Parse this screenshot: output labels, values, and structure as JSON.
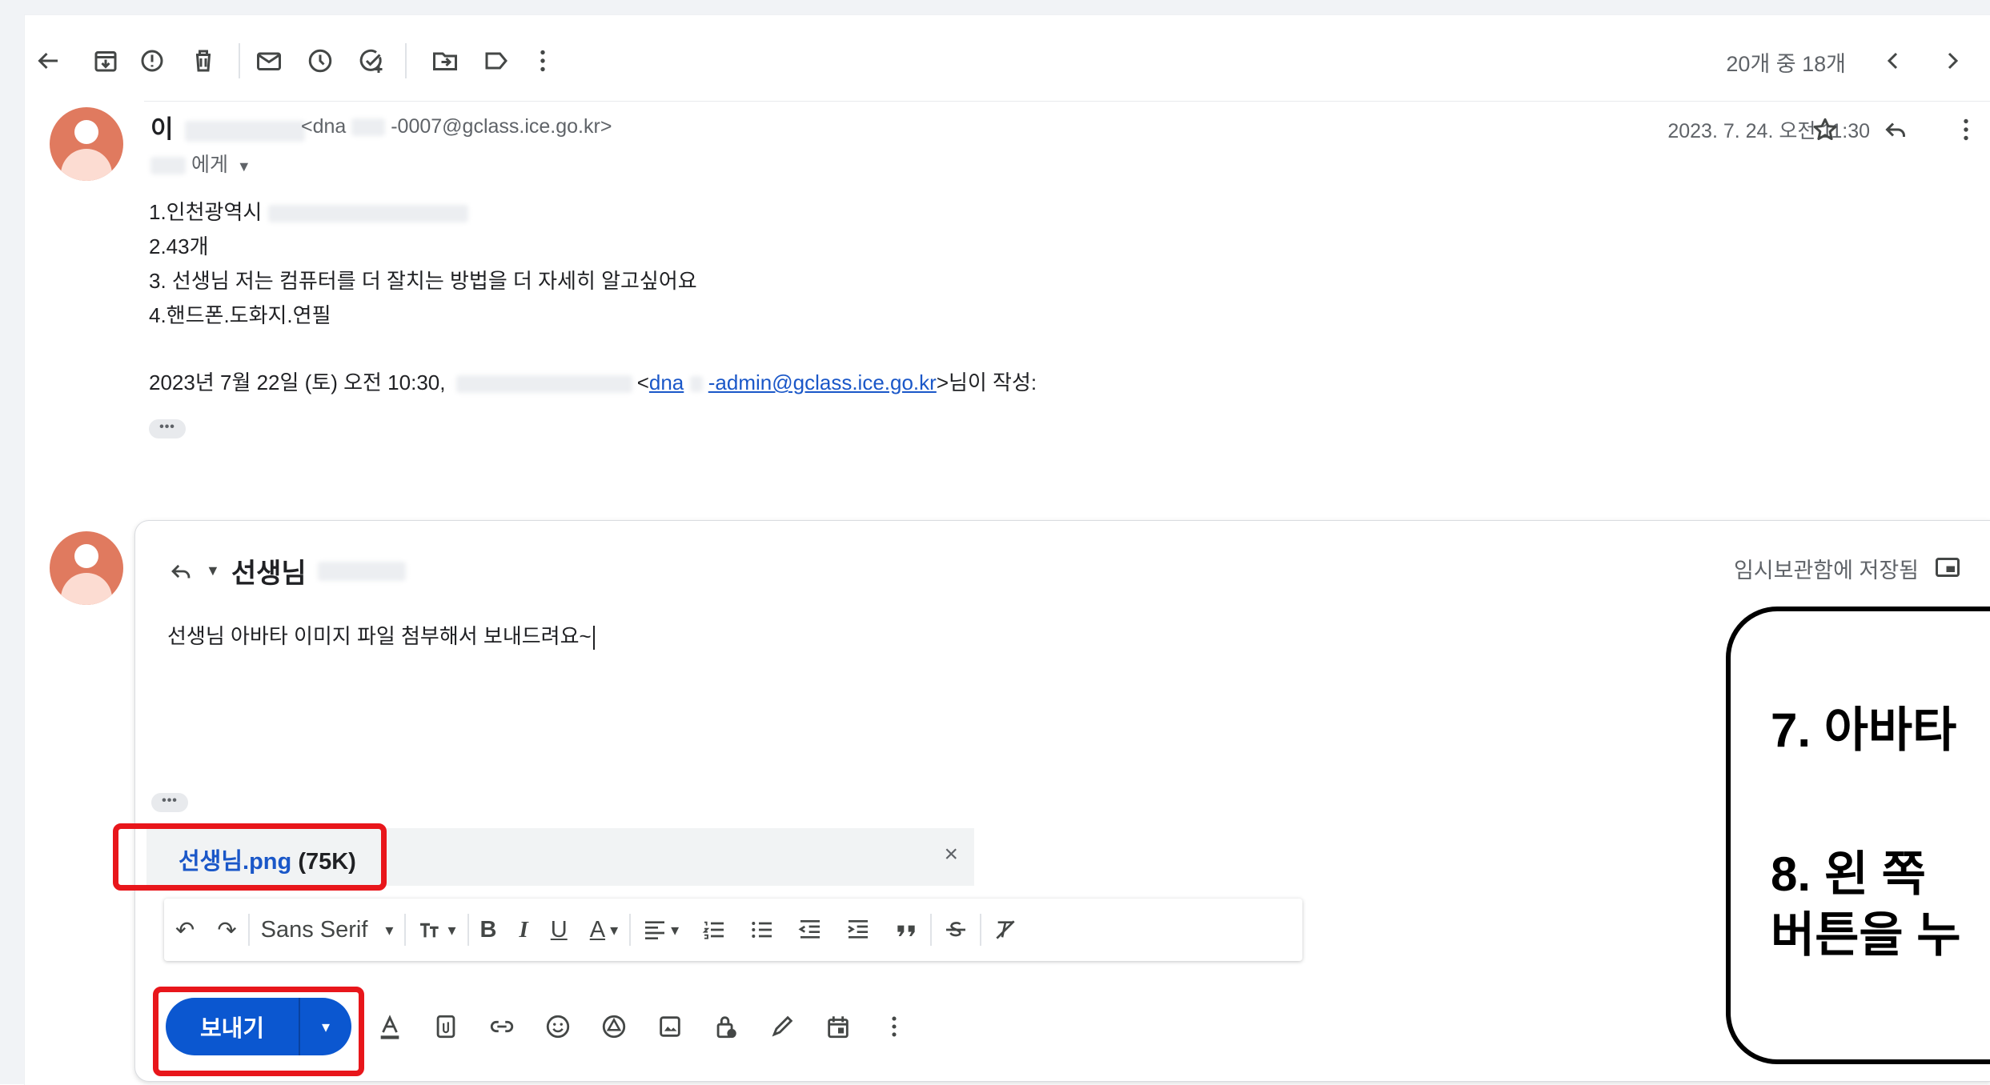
{
  "toolbar": {
    "pager_text": "20개 중 18개",
    "icons": [
      "back-arrow-icon",
      "archive-icon",
      "report-spam-icon",
      "delete-icon",
      "mark-unread-icon",
      "snooze-icon",
      "add-task-icon",
      "move-to-icon",
      "label-icon",
      "more-vert-icon",
      "chevron-left-icon",
      "chevron-right-icon"
    ]
  },
  "message": {
    "sender_name": "이",
    "sender_email_prefix": "<dna",
    "sender_email_suffix": "-0007@gclass.ice.go.kr>",
    "to_suffix": "에게",
    "date": "2023. 7. 24. 오전 11:30",
    "body_lines": [
      "1.인천광역시",
      "2.43개",
      "3. 선생님 저는 컴퓨터를 더 잘치는 방법을 더 자세히 알고싶어요",
      "4.핸드폰.도화지.연필"
    ],
    "quote_prefix": "2023년 7월 22일 (토) 오전 10:30,",
    "quote_email_open": "<",
    "quote_email_part1": "dna",
    "quote_email_part2": "-admin@gclass.ice.go.kr",
    "quote_suffix": ">님이 작성:",
    "ellipsis": "•••"
  },
  "reply": {
    "to_name": "선생님",
    "draft_status": "임시보관함에 저장됨",
    "compose_text": "선생님 아바타 이미지 파일 첨부해서 보내드려요~",
    "ellipsis": "•••",
    "attachment_name": "선생님.png",
    "attachment_size": "(75K)",
    "attachment_close": "×",
    "formatting": {
      "undo": "↶",
      "redo": "↷",
      "font_family": "Sans Serif",
      "bold": "B",
      "italic": "I",
      "underline": "U",
      "text_color": "A",
      "dropdown": "▾"
    },
    "send_label": "보내기",
    "send_dropdown": "▾"
  },
  "callout": {
    "line1": "7. 아바타",
    "line2": "8.  왼 쪽",
    "line3": "버튼을 누"
  },
  "colors": {
    "accent": "#0b57d0",
    "link": "#1a57c8",
    "highlight": "#e8161b",
    "avatar": "#e07a5f"
  }
}
